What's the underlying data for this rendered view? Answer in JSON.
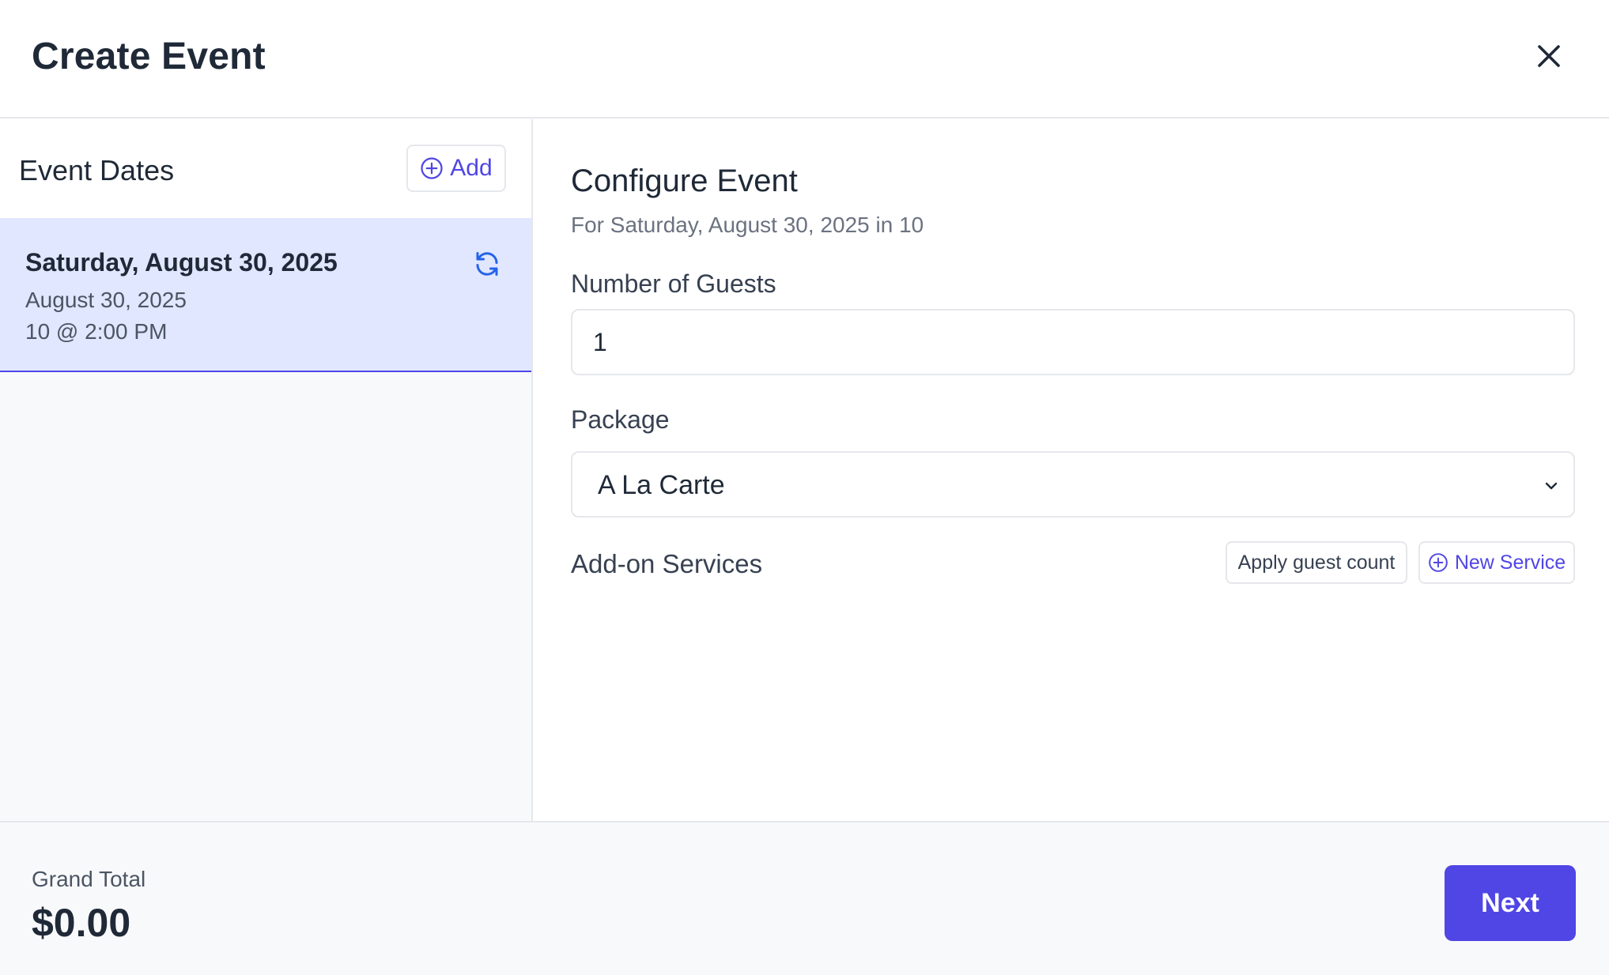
{
  "header": {
    "title": "Create Event",
    "close_icon": "close-icon"
  },
  "event_dates": {
    "label": "Event Dates",
    "add_label": "Add",
    "add_icon": "plus-circle-icon",
    "items": [
      {
        "title": "Saturday, August 30, 2025",
        "date": "August 30, 2025",
        "time": "10 @ 2:00 PM",
        "selected": true,
        "icon": "refresh-icon"
      }
    ]
  },
  "configure": {
    "title": "Configure Event",
    "subtitle": "For Saturday, August 30, 2025 in 10",
    "guests_label": "Number of Guests",
    "guests_value": "1",
    "package_label": "Package",
    "package_value": "A La Carte",
    "addons_label": "Add-on Services",
    "apply_label": "Apply guest count",
    "new_service_label": "New Service",
    "new_service_icon": "plus-circle-icon"
  },
  "footer": {
    "total_label": "Grand Total",
    "total_value": "$0.00",
    "next_label": "Next"
  },
  "colors": {
    "accent": "#4f46e5",
    "selected_bg": "#e0e7ff",
    "panel_bg": "#f8f9fb",
    "refresh_blue": "#2563eb"
  }
}
